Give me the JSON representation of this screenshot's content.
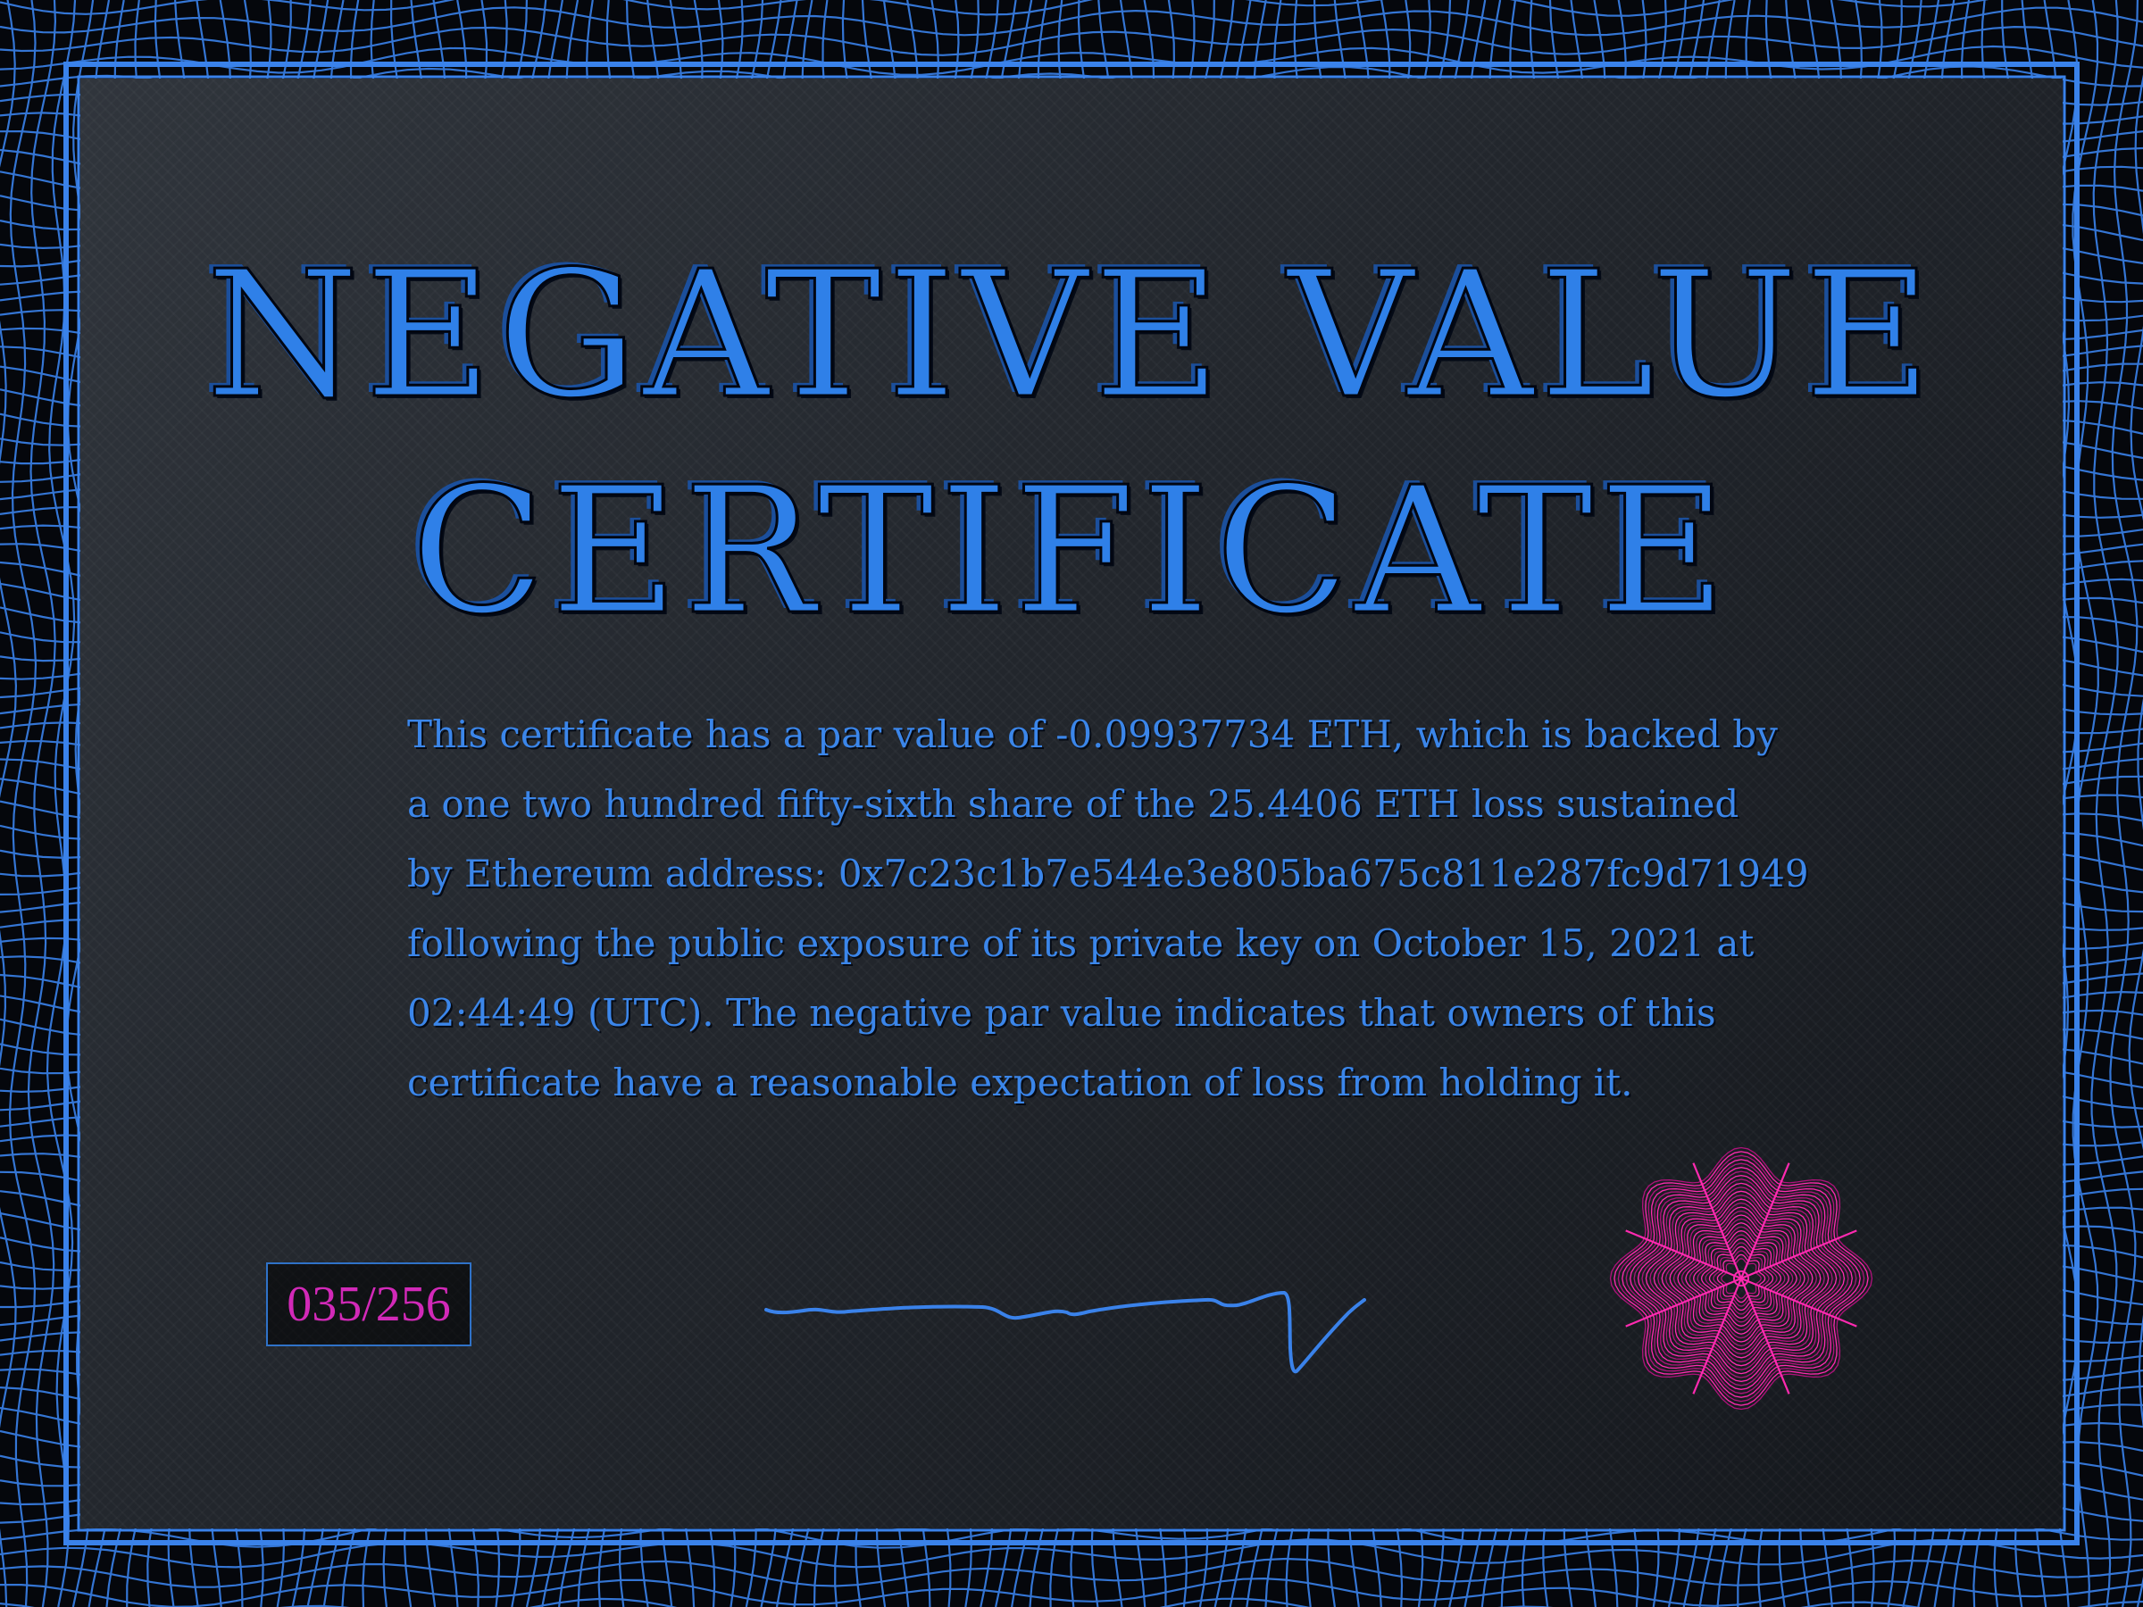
{
  "certificate": {
    "title_line_1": "NEGATIVE VALUE",
    "title_line_2": "CERTIFICATE",
    "body_lines": [
      "This certificate has a par value of -0.09937734 ETH, which is backed by",
      "a  one two hundred fifty-sixth  share of the 25.4406 ETH loss sustained",
      "by Ethereum address:   0x7c23c1b7e544e3e805ba675c811e287fc9d71949",
      "following the public exposure of its private key on  October 15, 2021  at",
      "02:44:49 (UTC).  The negative  par value  indicates that owners  of  this",
      "certificate have a reasonable expectation of loss from holding it."
    ],
    "serial_number": "035/256"
  },
  "colors": {
    "accent_blue": "#2f80e8",
    "seal_magenta": "#e0189a",
    "serial_magenta": "#d229b8",
    "background_dark": "#22262c"
  },
  "icons": {
    "seal": "rosette-seal-icon",
    "signature": "handwritten-signature"
  }
}
